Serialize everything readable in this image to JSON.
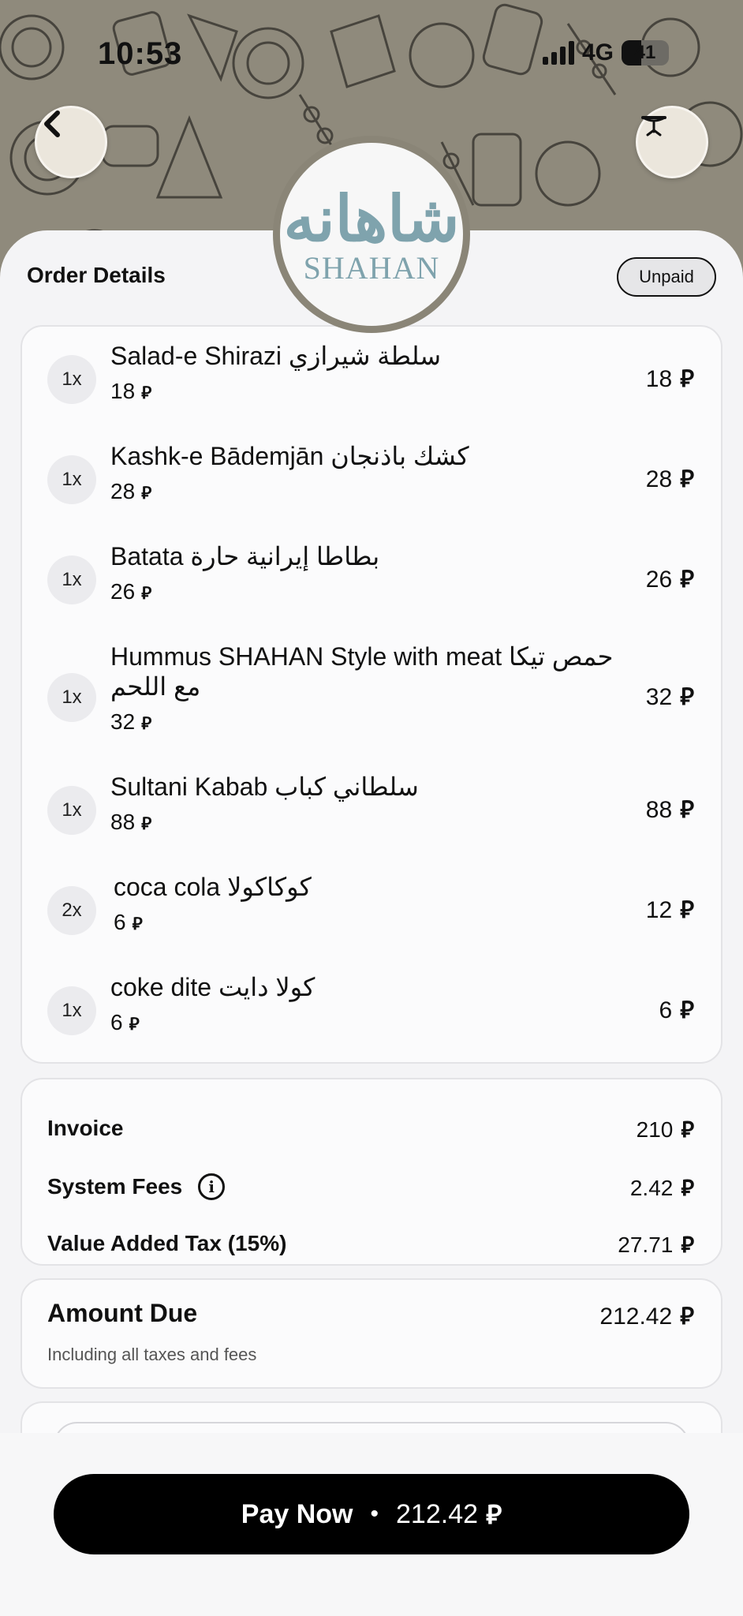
{
  "status_bar": {
    "time": "10:53",
    "network": "4G",
    "battery": "41",
    "battery_level": 0.41
  },
  "header": {
    "back_icon": "chevron-left-icon",
    "table_icon": "table-icon",
    "logo_arabic": "شاهانه",
    "logo_text": "SHAHAN"
  },
  "order": {
    "title": "Order Details",
    "status": "Unpaid",
    "currency": "⃁",
    "items": [
      {
        "qty": "1x",
        "name": "Salad-e Shirazi سلطة شيرازي",
        "unit": "18",
        "total": "18"
      },
      {
        "qty": "1x",
        "name": "Kashk-e Bādemjān كشك باذنجان",
        "unit": "28",
        "total": "28"
      },
      {
        "qty": "1x",
        "name": "Batata بطاطا إيرانية حارة",
        "unit": "26",
        "total": "26"
      },
      {
        "qty": "1x",
        "name": "Hummus SHAHAN Style with meat حمص تيكا مع اللحم",
        "unit": "32",
        "total": "32"
      },
      {
        "qty": "1x",
        "name": "Sultani Kabab سلطاني كباب",
        "unit": "88",
        "total": "88"
      },
      {
        "qty": "2x",
        "name": "coca cola كوكاكولا",
        "unit": "6",
        "total": "12"
      },
      {
        "qty": "1x",
        "name": "coke dite كولا دايت",
        "unit": "6",
        "total": "6"
      }
    ]
  },
  "summary": {
    "invoice_label": "Invoice",
    "invoice_value": "210",
    "fees_label": "System Fees",
    "fees_value": "2.42",
    "vat_label": "Value Added Tax (15%)",
    "vat_value": "27.71"
  },
  "amount_due": {
    "label": "Amount Due",
    "value": "212.42",
    "subtitle": "Including all taxes and fees"
  },
  "pay": {
    "label": "Pay Now",
    "separator": "•",
    "amount": "212.42"
  }
}
